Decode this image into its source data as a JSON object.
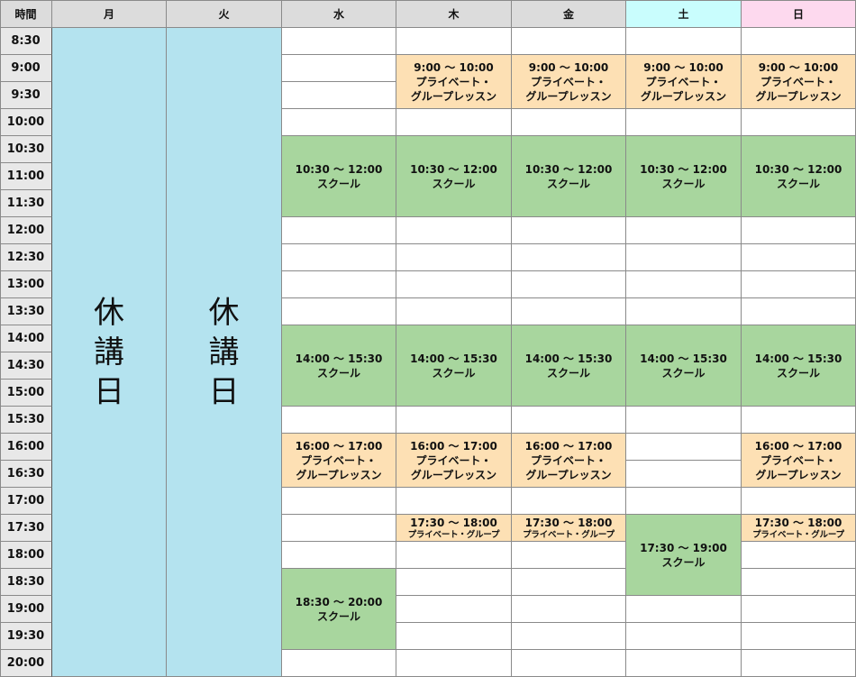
{
  "header": {
    "time_label": "時間",
    "days": [
      {
        "key": "mon",
        "label": "月",
        "tone": "normal"
      },
      {
        "key": "tue",
        "label": "火",
        "tone": "normal"
      },
      {
        "key": "wed",
        "label": "水",
        "tone": "normal"
      },
      {
        "key": "thu",
        "label": "木",
        "tone": "normal"
      },
      {
        "key": "fri",
        "label": "金",
        "tone": "normal"
      },
      {
        "key": "sat",
        "label": "土",
        "tone": "sat"
      },
      {
        "key": "sun",
        "label": "日",
        "tone": "sun"
      }
    ]
  },
  "times": [
    "8:30",
    "9:00",
    "9:30",
    "10:00",
    "10:30",
    "11:00",
    "11:30",
    "12:00",
    "12:30",
    "13:00",
    "13:30",
    "14:00",
    "14:30",
    "15:00",
    "15:30",
    "16:00",
    "16:30",
    "17:00",
    "17:30",
    "18:00",
    "18:30",
    "19:00",
    "19:30",
    "20:00"
  ],
  "closed_label": "休講日",
  "colors": {
    "school": "#a8d69e",
    "private": "#fde0b4",
    "closed": "#b4e3ef",
    "saturday_header": "#c9fdfd",
    "sunday_header": "#fdd9ee",
    "header": "#dcdcdc"
  },
  "closed_days": [
    "mon",
    "tue"
  ],
  "events": [
    {
      "day": "thu",
      "start": "9:00",
      "end": "10:00",
      "kind": "private",
      "time_text": "9:00 〜 10:00",
      "title": "プライベート・",
      "title2": "グループレッスン",
      "compact": false
    },
    {
      "day": "fri",
      "start": "9:00",
      "end": "10:00",
      "kind": "private",
      "time_text": "9:00 〜 10:00",
      "title": "プライベート・",
      "title2": "グループレッスン",
      "compact": false
    },
    {
      "day": "sat",
      "start": "9:00",
      "end": "10:00",
      "kind": "private",
      "time_text": "9:00 〜 10:00",
      "title": "プライベート・",
      "title2": "グループレッスン",
      "compact": false
    },
    {
      "day": "sun",
      "start": "9:00",
      "end": "10:00",
      "kind": "private",
      "time_text": "9:00 〜 10:00",
      "title": "プライベート・",
      "title2": "グループレッスン",
      "compact": false
    },
    {
      "day": "wed",
      "start": "10:30",
      "end": "12:00",
      "kind": "school",
      "time_text": "10:30 〜 12:00",
      "title": "スクール",
      "title2": "",
      "compact": false
    },
    {
      "day": "thu",
      "start": "10:30",
      "end": "12:00",
      "kind": "school",
      "time_text": "10:30 〜 12:00",
      "title": "スクール",
      "title2": "",
      "compact": false
    },
    {
      "day": "fri",
      "start": "10:30",
      "end": "12:00",
      "kind": "school",
      "time_text": "10:30 〜 12:00",
      "title": "スクール",
      "title2": "",
      "compact": false
    },
    {
      "day": "sat",
      "start": "10:30",
      "end": "12:00",
      "kind": "school",
      "time_text": "10:30 〜 12:00",
      "title": "スクール",
      "title2": "",
      "compact": false
    },
    {
      "day": "sun",
      "start": "10:30",
      "end": "12:00",
      "kind": "school",
      "time_text": "10:30 〜 12:00",
      "title": "スクール",
      "title2": "",
      "compact": false
    },
    {
      "day": "wed",
      "start": "14:00",
      "end": "15:30",
      "kind": "school",
      "time_text": "14:00 〜 15:30",
      "title": "スクール",
      "title2": "",
      "compact": false
    },
    {
      "day": "thu",
      "start": "14:00",
      "end": "15:30",
      "kind": "school",
      "time_text": "14:00 〜 15:30",
      "title": "スクール",
      "title2": "",
      "compact": false
    },
    {
      "day": "fri",
      "start": "14:00",
      "end": "15:30",
      "kind": "school",
      "time_text": "14:00 〜 15:30",
      "title": "スクール",
      "title2": "",
      "compact": false
    },
    {
      "day": "sat",
      "start": "14:00",
      "end": "15:30",
      "kind": "school",
      "time_text": "14:00 〜 15:30",
      "title": "スクール",
      "title2": "",
      "compact": false
    },
    {
      "day": "sun",
      "start": "14:00",
      "end": "15:30",
      "kind": "school",
      "time_text": "14:00 〜 15:30",
      "title": "スクール",
      "title2": "",
      "compact": false
    },
    {
      "day": "wed",
      "start": "16:00",
      "end": "17:00",
      "kind": "private",
      "time_text": "16:00 〜 17:00",
      "title": "プライベート・",
      "title2": "グループレッスン",
      "compact": false
    },
    {
      "day": "thu",
      "start": "16:00",
      "end": "17:00",
      "kind": "private",
      "time_text": "16:00 〜 17:00",
      "title": "プライベート・",
      "title2": "グループレッスン",
      "compact": false
    },
    {
      "day": "fri",
      "start": "16:00",
      "end": "17:00",
      "kind": "private",
      "time_text": "16:00 〜 17:00",
      "title": "プライベート・",
      "title2": "グループレッスン",
      "compact": false
    },
    {
      "day": "sun",
      "start": "16:00",
      "end": "17:00",
      "kind": "private",
      "time_text": "16:00 〜 17:00",
      "title": "プライベート・",
      "title2": "グループレッスン",
      "compact": false
    },
    {
      "day": "thu",
      "start": "17:30",
      "end": "18:00",
      "kind": "private",
      "time_text": "17:30 〜 18:00",
      "title": "プライベート・グループ",
      "title2": "",
      "compact": true
    },
    {
      "day": "fri",
      "start": "17:30",
      "end": "18:00",
      "kind": "private",
      "time_text": "17:30 〜 18:00",
      "title": "プライベート・グループ",
      "title2": "",
      "compact": true
    },
    {
      "day": "sun",
      "start": "17:30",
      "end": "18:00",
      "kind": "private",
      "time_text": "17:30 〜 18:00",
      "title": "プライベート・グループ",
      "title2": "",
      "compact": true
    },
    {
      "day": "sat",
      "start": "17:30",
      "end": "19:00",
      "kind": "school",
      "time_text": "17:30 〜 19:00",
      "title": "スクール",
      "title2": "",
      "compact": false
    },
    {
      "day": "wed",
      "start": "18:30",
      "end": "20:00",
      "kind": "school",
      "time_text": "18:30 〜 20:00",
      "title": "スクール",
      "title2": "",
      "compact": false
    }
  ]
}
